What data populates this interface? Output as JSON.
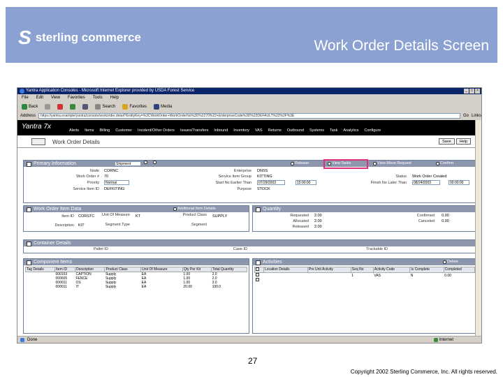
{
  "slide": {
    "logo_text": "sterling commerce",
    "title": "Work Order Details  Screen",
    "page_number": "27",
    "copyright": "Copyright 2002 Sterling Commerce, Inc. All rights reserved."
  },
  "browser": {
    "title": "Yantra Application Consoles - Microsoft Internet Explorer provided by USDA Forest Service",
    "menu": [
      "File",
      "Edit",
      "View",
      "Favorites",
      "Tools",
      "Help"
    ],
    "toolbar": [
      "Back",
      "Search",
      "Favorites",
      "Media"
    ],
    "address_label": "Address",
    "address_value": "https://yantra.example/yantra/console/workorder.detail?EntityKey=%3CWorkOrder+WorkOrderNo%3D%2270%22+EnterpriseCode%3D%22DEFAULT%22%2F%3E",
    "go_label": "Go",
    "links_label": "Links",
    "status_left": "Done",
    "status_right": "Internet"
  },
  "app": {
    "product": "Yantra 7x",
    "nav": [
      "Alerts",
      "Items",
      "Billing",
      "Customer",
      "Incident/Other Orders",
      "Issues/Transfers",
      "Inbound",
      "Inventory",
      "VAS",
      "Returns",
      "Outbound",
      "Systems",
      "Task",
      "Analytics",
      "Configure"
    ],
    "page_title": "Work Order Details",
    "page_buttons": [
      "Save",
      "Help"
    ],
    "primary": {
      "header": "Primary Information",
      "view_select": "Shipment",
      "actions": [
        "Release",
        "View Tasks",
        "View Move Request",
        "Confirm"
      ],
      "node_label": "Node",
      "node_value": "CORNC",
      "workorder_label": "Work Order #",
      "workorder_value": "70",
      "priority_label": "Priority",
      "priority_value": "Normal",
      "service_label": "Service Item ID",
      "service_value": "DEFKITING",
      "enterprise_label": "Enterprise",
      "enterprise_value": "DNSS",
      "service_group_label": "Service Item Group",
      "service_group_value": "KITTING",
      "start_label": "Start No Earlier Than",
      "start_date": "07/29/2003",
      "start_time": "15:00:00",
      "purpose_label": "Purpose",
      "purpose_value": "STOCK",
      "status_label": "Status",
      "status_value": "Work Order Created",
      "finish_label": "Finish No Later Than",
      "finish_date": "08/24/2003",
      "finish_time": "00:00:00"
    },
    "item": {
      "header": "Work Order Item Data",
      "action": "Additional Item Details",
      "item_id_label": "Item ID",
      "item_id_value": "CORSTC",
      "desc_label": "Description",
      "desc_value": "KIT",
      "uom_label": "Unit Of Measure",
      "uom_value": "KT",
      "segtype_label": "Segment Type",
      "segtype_value": "",
      "product_class_label": "Product Class",
      "product_class_value": "SUPPLY",
      "segment_label": "Segment",
      "segment_value": ""
    },
    "quantity": {
      "header": "Quantity",
      "requested_label": "Requested",
      "requested_value": "2.00",
      "allocated_label": "Allocated",
      "allocated_value": "2.00",
      "released_label": "Released",
      "released_value": "2.00",
      "confirmed_label": "Confirmed",
      "confirmed_value": "0.00",
      "canceled_label": "Canceled",
      "canceled_value": "0.00"
    },
    "container": {
      "header": "Container Details",
      "pallet_label": "Pallet ID",
      "case_label": "Case ID",
      "trackable_label": "Trackable ID"
    },
    "components": {
      "header": "Component Items",
      "columns": [
        "Tag Details",
        "Item ID",
        "Description",
        "Product Class",
        "Unit Of Measure",
        "Qty Per Kit",
        "Total Quantity"
      ],
      "rows": [
        [
          "",
          "000153",
          "CAPTION",
          "Supply",
          "EA",
          "1.00",
          "2.0"
        ],
        [
          "",
          "000605",
          "FENCE",
          "Supply",
          "EA",
          "1.00",
          "2.0"
        ],
        [
          "",
          "000011",
          "OS",
          "Supply",
          "EA",
          "1.00",
          "2.0"
        ],
        [
          "",
          "000011",
          "IT",
          "Supply",
          "EA",
          "20.00",
          "100.0"
        ]
      ]
    },
    "activities": {
      "header": "Activities",
      "action": "Delete",
      "columns": [
        "",
        "Location Details",
        "Pre Unit Activity",
        "Seq No",
        "Activity Code",
        "Is Complete",
        "Completed"
      ],
      "rows": [
        [
          "",
          "",
          "",
          "1",
          "VAS",
          "N",
          "0.00"
        ],
        [
          "",
          "",
          "",
          "",
          "",
          "",
          ""
        ]
      ]
    }
  }
}
